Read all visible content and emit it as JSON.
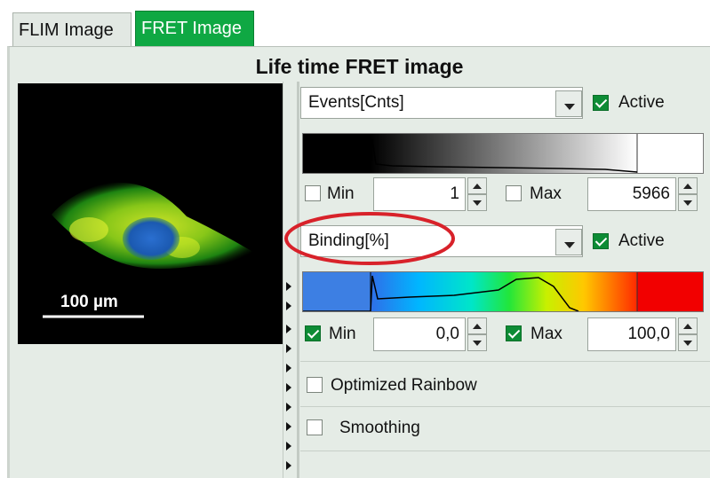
{
  "tabs": [
    {
      "label": "FLIM Image",
      "active": false
    },
    {
      "label": "FRET Image",
      "active": true
    }
  ],
  "panel_title": "Life time FRET image",
  "image": {
    "scale_bar_label": "100 µm"
  },
  "intensity": {
    "dropdown_value": "Events[Cnts]",
    "active_label": "Active",
    "active_checked": true,
    "min_label": "Min",
    "min_checked": false,
    "min_value": "1",
    "max_label": "Max",
    "max_checked": false,
    "max_value": "5966"
  },
  "fret": {
    "dropdown_value": "Binding[%]",
    "active_label": "Active",
    "active_checked": true,
    "min_label": "Min",
    "min_checked": true,
    "min_value": "0,0",
    "max_label": "Max",
    "max_checked": true,
    "max_value": "100,0"
  },
  "options": {
    "optimized_rainbow_label": "Optimized Rainbow",
    "optimized_rainbow_checked": false,
    "smoothing_label": "Smoothing",
    "smoothing_checked": false
  },
  "colors": {
    "tab_active": "#0fa843",
    "panel_bg": "#e5ece6",
    "check_on": "#0d8c35",
    "highlight_ellipse": "#d8222a"
  },
  "icons": [
    "dropdown-arrow-icon",
    "spin-up-icon",
    "spin-down-icon",
    "collapse-arrow-icon"
  ]
}
